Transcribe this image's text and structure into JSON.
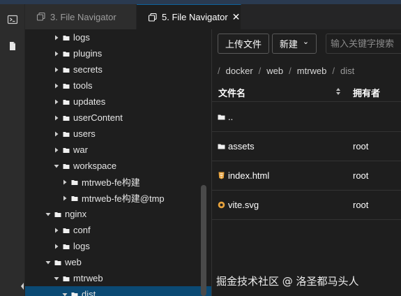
{
  "tabs": [
    {
      "label": "3. File Navigator",
      "active": false
    },
    {
      "label": "5. File Navigator",
      "active": true
    }
  ],
  "tab_close_glyph": "✕",
  "tree": [
    {
      "label": "logs",
      "depth": 2,
      "expanded": false
    },
    {
      "label": "plugins",
      "depth": 2,
      "expanded": false
    },
    {
      "label": "secrets",
      "depth": 2,
      "expanded": false
    },
    {
      "label": "tools",
      "depth": 2,
      "expanded": false
    },
    {
      "label": "updates",
      "depth": 2,
      "expanded": false
    },
    {
      "label": "userContent",
      "depth": 2,
      "expanded": false
    },
    {
      "label": "users",
      "depth": 2,
      "expanded": false
    },
    {
      "label": "war",
      "depth": 2,
      "expanded": false
    },
    {
      "label": "workspace",
      "depth": 2,
      "expanded": true
    },
    {
      "label": "mtrweb-fe构建",
      "depth": 3,
      "expanded": false
    },
    {
      "label": "mtrweb-fe构建@tmp",
      "depth": 3,
      "expanded": false
    },
    {
      "label": "nginx",
      "depth": 1,
      "expanded": true
    },
    {
      "label": "conf",
      "depth": 2,
      "expanded": false
    },
    {
      "label": "logs",
      "depth": 2,
      "expanded": false
    },
    {
      "label": "web",
      "depth": 1,
      "expanded": true
    },
    {
      "label": "mtrweb",
      "depth": 2,
      "expanded": true
    },
    {
      "label": "dist",
      "depth": 3,
      "expanded": true,
      "selected": true
    }
  ],
  "toolbar": {
    "upload_label": "上传文件",
    "new_label": "新建",
    "new_caret": "⌄",
    "search_placeholder": "输入关键字搜索"
  },
  "breadcrumb": [
    "docker",
    "web",
    "mtrweb",
    "dist"
  ],
  "breadcrumb_sep": "/",
  "table": {
    "headers": {
      "name": "文件名",
      "owner": "拥有者"
    },
    "rows": [
      {
        "name": "..",
        "owner": "",
        "icon": "folder-icon"
      },
      {
        "name": "assets",
        "owner": "root",
        "icon": "folder-icon"
      },
      {
        "name": "index.html",
        "owner": "root",
        "icon": "html-file-icon"
      },
      {
        "name": "vite.svg",
        "owner": "root",
        "icon": "svg-file-icon"
      }
    ]
  },
  "watermark": "掘金技术社区 @ 洛圣都马头人",
  "colors": {
    "accent": "#0e639c",
    "selected_row": "#0b4a74",
    "html_icon": "#e8a33d",
    "svg_icon": "#e8a33d"
  }
}
